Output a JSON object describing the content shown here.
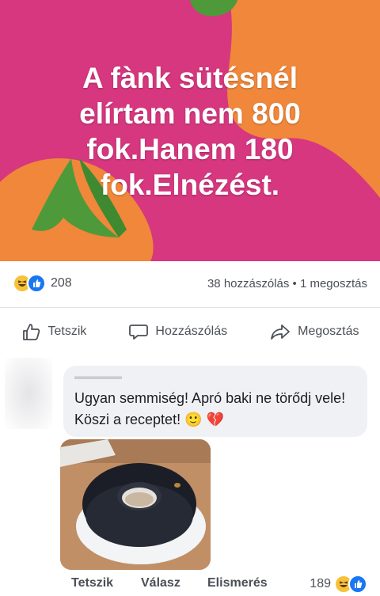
{
  "post": {
    "image_text": "A fànk sütésnél elírtam nem 800 fok.Hanem 180 fok.Elnézést.",
    "image_colors": {
      "background": "#d6377f",
      "orange": "#f0873a",
      "green": "#4e9a3a"
    }
  },
  "stats": {
    "reaction_icons": [
      "haha-icon",
      "like-icon"
    ],
    "reaction_count": "208",
    "comments_shares": "38 hozzászólás • 1 megosztás"
  },
  "actions": {
    "like": "Tetszik",
    "comment": "Hozzászólás",
    "share": "Megosztás"
  },
  "comment": {
    "text": "Ugyan semmiség! Apró baki ne törődj vele! Köszi a receptet! 🙂 💔",
    "photo_icon": "burnt-cake-photo"
  },
  "comment_footer": {
    "like": "Tetszik",
    "reply": "Válasz",
    "acknowledge": "Elismerés",
    "reaction_count": "189"
  }
}
